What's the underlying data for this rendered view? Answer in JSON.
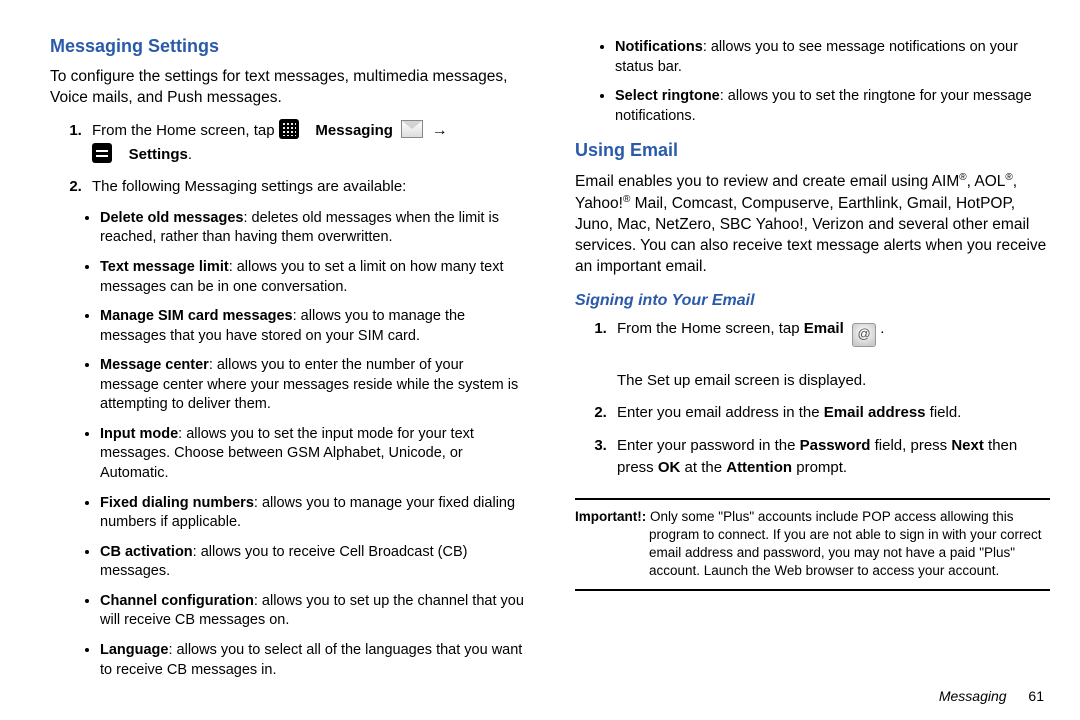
{
  "left": {
    "heading": "Messaging Settings",
    "intro": "To configure the settings for text messages, multimedia messages, Voice mails, and Push messages.",
    "step1_a": "From the Home screen, tap ",
    "step1_msg": "Messaging",
    "step1_arrow": "→",
    "step1_settings": "Settings",
    "step2": "The following Messaging settings are available:",
    "bullets": [
      {
        "t": "Delete old messages",
        "d": ": deletes old messages when the limit is reached, rather than having them overwritten."
      },
      {
        "t": "Text message limit",
        "d": ": allows you to set a limit on how many text messages can be in one conversation."
      },
      {
        "t": "Manage SIM card messages",
        "d": ": allows you to manage the messages that you have stored on your SIM card."
      },
      {
        "t": "Message center",
        "d": ": allows you to enter the number of your message center where your messages reside while the system is attempting to deliver them."
      },
      {
        "t": "Input mode",
        "d": ": allows you to set the input mode for your text messages. Choose between GSM Alphabet, Unicode, or Automatic."
      },
      {
        "t": "Fixed dialing numbers",
        "d": ": allows you to manage your fixed dialing numbers if applicable."
      },
      {
        "t": "CB activation",
        "d": ": allows you to receive Cell Broadcast (CB) messages."
      },
      {
        "t": "Channel configuration",
        "d": ": allows you to set up the channel that you will receive CB messages on."
      },
      {
        "t": "Language",
        "d": ": allows you to select all of the languages that you want to receive CB messages in."
      }
    ]
  },
  "right": {
    "top_bullets": [
      {
        "t": "Notifications",
        "d": ": allows you to see message notifications on your status bar."
      },
      {
        "t": "Select ringtone",
        "d": ": allows you to set the ringtone for your message notifications."
      }
    ],
    "heading": "Using Email",
    "intro_a": "Email enables you to review and create email using AIM",
    "intro_b": ", AOL",
    "intro_c": ", Yahoo!",
    "intro_d": " Mail, Comcast, Compuserve, Earthlink, Gmail, HotPOP, Juno, Mac, NetZero, SBC Yahoo!, Verizon and several other email services. You can also receive text message alerts when you receive an important email.",
    "sub_heading": "Signing into Your Email",
    "s1_a": "From the Home screen, tap ",
    "s1_b": "Email",
    "s1_at": "@",
    "s1_c": "The Set up email screen is displayed.",
    "s2_a": "Enter you email address in the ",
    "s2_b": "Email address",
    "s2_c": " field.",
    "s3_a": "Enter your password in the ",
    "s3_b": "Password",
    "s3_c": " field, press ",
    "s3_d": "Next",
    "s3_e": " then press ",
    "s3_f": "OK",
    "s3_g": " at the ",
    "s3_h": "Attention",
    "s3_i": " prompt.",
    "important_label": "Important!:",
    "important_body": " Only some \"Plus\" accounts include POP access allowing this program to connect. If you are not able to sign in with your correct email address and password, you may not have a paid \"Plus\" account. Launch the Web browser to access your account."
  },
  "footer": {
    "section": "Messaging",
    "page": "61"
  }
}
